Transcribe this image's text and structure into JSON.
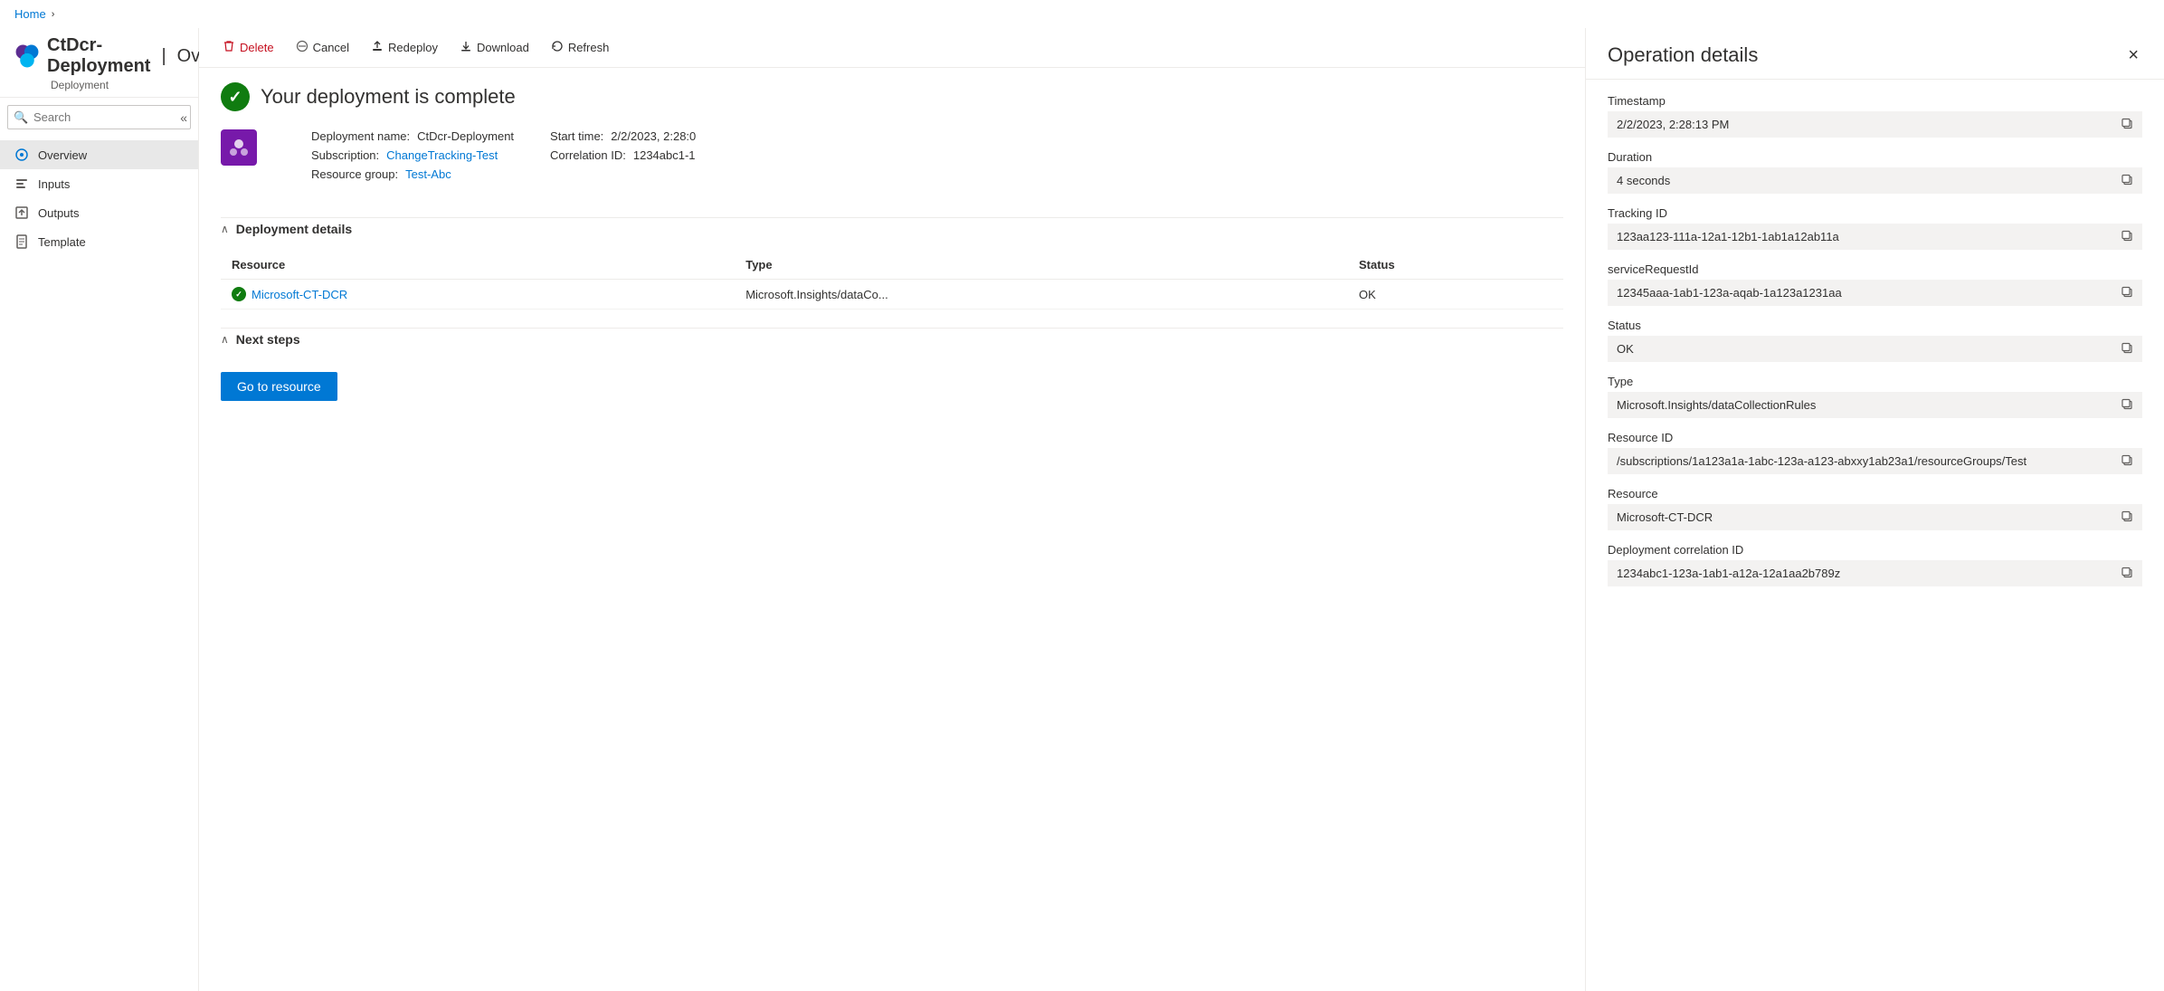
{
  "breadcrumb": {
    "home": "Home",
    "chevron": "›"
  },
  "header": {
    "icon_alt": "azure-deployment-icon",
    "title": "CtDcr-Deployment",
    "separator": "|",
    "subtitle": "Overview",
    "page_subtitle": "Deployment",
    "pin_icon": "📌",
    "more_icon": "···"
  },
  "sidebar": {
    "search_placeholder": "Search",
    "collapse_icon": "«",
    "items": [
      {
        "id": "overview",
        "label": "Overview",
        "icon": "overview",
        "active": true
      },
      {
        "id": "inputs",
        "label": "Inputs",
        "icon": "inputs"
      },
      {
        "id": "outputs",
        "label": "Outputs",
        "icon": "outputs"
      },
      {
        "id": "template",
        "label": "Template",
        "icon": "template"
      }
    ]
  },
  "toolbar": {
    "delete_label": "Delete",
    "cancel_label": "Cancel",
    "redeploy_label": "Redeploy",
    "download_label": "Download",
    "refresh_label": "Refresh"
  },
  "main": {
    "success_title": "Your deployment is complete",
    "deployment_info": {
      "name_label": "Deployment name:",
      "name_value": "CtDcr-Deployment",
      "subscription_label": "Subscription:",
      "subscription_value": "ChangeTracking-Test",
      "resource_group_label": "Resource group:",
      "resource_group_value": "Test-Abc",
      "start_time_label": "Start time:",
      "start_time_value": "2/2/2023, 2:28:0",
      "correlation_label": "Correlation ID:",
      "correlation_value": "1234abc1-1"
    },
    "deployment_details": {
      "section_label": "Deployment details",
      "table": {
        "headers": [
          "Resource",
          "Type",
          "Status"
        ],
        "rows": [
          {
            "resource": "Microsoft-CT-DCR",
            "type": "Microsoft.Insights/dataCo...",
            "status": "OK"
          }
        ]
      }
    },
    "next_steps": {
      "section_label": "Next steps",
      "go_to_resource_label": "Go to resource"
    }
  },
  "operation_details": {
    "panel_title": "Operation details",
    "close_icon": "×",
    "fields": [
      {
        "id": "timestamp",
        "label": "Timestamp",
        "value": "2/2/2023, 2:28:13 PM"
      },
      {
        "id": "duration",
        "label": "Duration",
        "value": "4 seconds"
      },
      {
        "id": "tracking_id",
        "label": "Tracking ID",
        "value": "123aa123-111a-12a1-12b1-1ab1a12ab11a"
      },
      {
        "id": "service_request_id",
        "label": "serviceRequestId",
        "value": "12345aaa-1ab1-123a-aqab-1a123a1231aa"
      },
      {
        "id": "status",
        "label": "Status",
        "value": "OK"
      },
      {
        "id": "type",
        "label": "Type",
        "value": "Microsoft.Insights/dataCollectionRules"
      },
      {
        "id": "resource_id",
        "label": "Resource ID",
        "value": "/subscriptions/1a123a1a-1abc-123a-a123-abxxy1ab23a1/resourceGroups/Test"
      },
      {
        "id": "resource",
        "label": "Resource",
        "value": "Microsoft-CT-DCR"
      },
      {
        "id": "deployment_correlation_id",
        "label": "Deployment correlation ID",
        "value": "1234abc1-123a-1ab1-a12a-12a1aa2b789z"
      }
    ]
  },
  "icons": {
    "search": "🔍",
    "overview": "⊙",
    "inputs": "📥",
    "outputs": "📤",
    "template": "📄",
    "delete": "🗑",
    "cancel": "⊘",
    "redeploy": "⬆",
    "download": "⬇",
    "refresh": "↻",
    "copy": "⧉",
    "chevron_down": "∧",
    "check": "✓"
  }
}
